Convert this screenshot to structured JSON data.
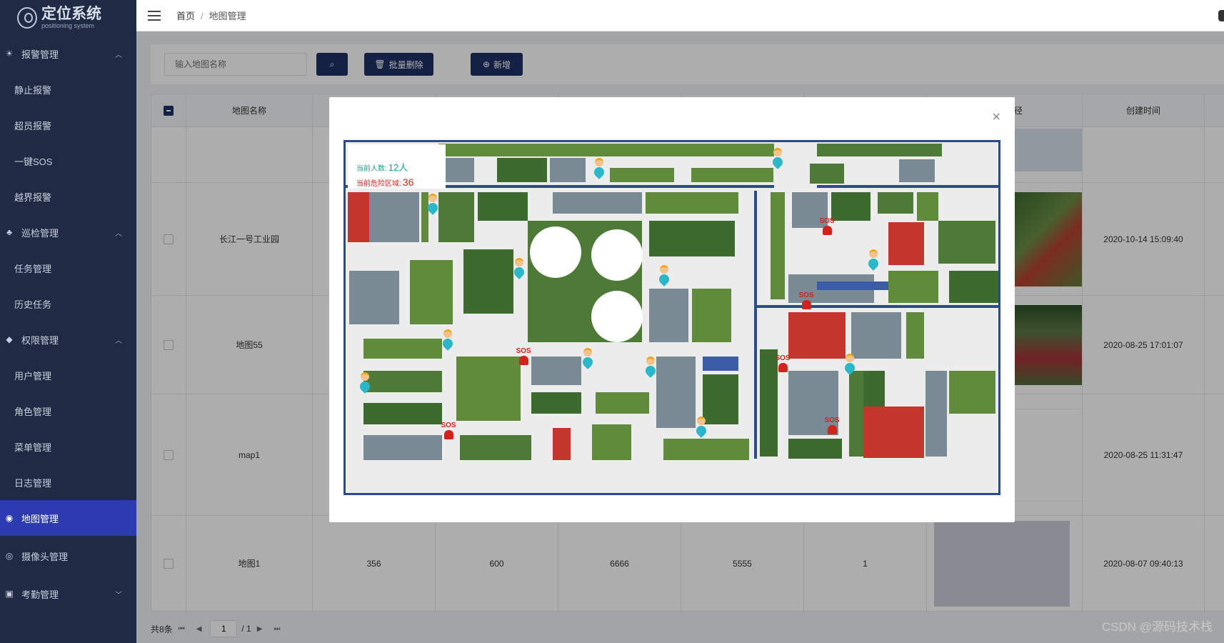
{
  "app": {
    "title": "定位系统",
    "subtitle": "positioning system"
  },
  "sidebar": {
    "groups": [
      {
        "label": "报警管理",
        "icon": "alarm-icon",
        "items": [
          "静止报警",
          "超员报警",
          "一键SOS",
          "越界报警"
        ]
      },
      {
        "label": "巡检管理",
        "icon": "patrol-icon",
        "items": [
          "任务管理",
          "历史任务"
        ]
      },
      {
        "label": "权限管理",
        "icon": "shield-icon",
        "items": [
          "用户管理",
          "角色管理",
          "菜单管理",
          "日志管理"
        ]
      },
      {
        "label": "地图管理",
        "icon": "map-icon",
        "active": true
      },
      {
        "label": "摄像头管理",
        "icon": "camera-icon"
      },
      {
        "label": "考勤管理",
        "icon": "attendance-icon"
      }
    ]
  },
  "header": {
    "breadcrumb": {
      "home": "首页",
      "current": "地图管理"
    }
  },
  "toolbar": {
    "search_placeholder": "输入地图名称",
    "batch_delete_label": "批量删除",
    "add_label": "新增"
  },
  "table": {
    "columns": [
      "地图名称",
      "",
      "",
      "",
      "",
      "",
      "径",
      "创建时间"
    ],
    "rows": [
      {
        "name": "",
        "c2": "",
        "c3": "",
        "c4": "",
        "c5": "",
        "c6": "",
        "created": ""
      },
      {
        "name": "长江一号工业园",
        "c2": "",
        "c3": "",
        "c4": "",
        "c5": "",
        "c6": "",
        "created": "2020-10-14 15:09:40"
      },
      {
        "name": "地图55",
        "c2": "",
        "c3": "",
        "c4": "",
        "c5": "",
        "c6": "",
        "created": "2020-08-25 17:01:07"
      },
      {
        "name": "map1",
        "c2": "",
        "c3": "",
        "c4": "",
        "c5": "",
        "c6": "",
        "created": "2020-08-25 11:31:47"
      },
      {
        "name": "地图1",
        "c2": "356",
        "c3": "600",
        "c4": "6666",
        "c5": "5555",
        "c6": "1",
        "created": "2020-08-07 09:40:13"
      }
    ]
  },
  "pagination": {
    "total": "共8条",
    "page": "1",
    "pages": "/ 1"
  },
  "modal": {
    "close": "×",
    "stats": {
      "people_label": "当前人数:",
      "people_value": "12人",
      "danger_label": "当前危险区域:",
      "danger_value": "36"
    },
    "sos_label": "SOS"
  },
  "watermark": "CSDN @源码技术栈",
  "colors": {
    "sidebar": "#1f2a44",
    "active": "#2d3bb0",
    "button": "#1f3066",
    "sos": "#d0231b",
    "stats": "#17a28c"
  }
}
